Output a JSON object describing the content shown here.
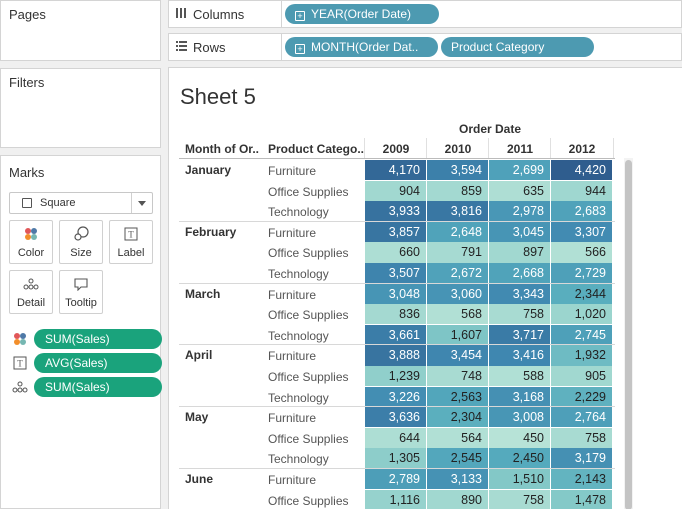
{
  "panels": {
    "pages": "Pages",
    "filters": "Filters",
    "marks": "Marks"
  },
  "marks": {
    "type": "Square",
    "buttons": [
      {
        "label": "Color",
        "icon": "color-dots-icon"
      },
      {
        "label": "Size",
        "icon": "size-icon"
      },
      {
        "label": "Label",
        "icon": "text-label-icon"
      },
      {
        "label": "Detail",
        "icon": "detail-dots-icon"
      },
      {
        "label": "Tooltip",
        "icon": "tooltip-icon"
      }
    ],
    "pills": [
      {
        "label": "SUM(Sales)",
        "icon": "color-dots-icon"
      },
      {
        "label": "AVG(Sales)",
        "icon": "text-label-icon"
      },
      {
        "label": "SUM(Sales)",
        "icon": "detail-dots-icon"
      }
    ]
  },
  "shelves": {
    "columns": {
      "label": "Columns",
      "pills": [
        "YEAR(Order Date)"
      ]
    },
    "rows": {
      "label": "Rows",
      "pills": [
        "MONTH(Order Dat..",
        "Product Category"
      ]
    }
  },
  "sheet": {
    "title": "Sheet 5",
    "column_group": "Order Date",
    "row_headers": [
      "Month of Or..",
      "Product Catego.."
    ],
    "years": [
      "2009",
      "2010",
      "2011",
      "2012"
    ]
  },
  "colors": {
    "pill_green": "#1aa37c",
    "pill_blue": "#4d9ab1",
    "scale_low": "#b7e3d7",
    "scale_high": "#2f5d8e"
  },
  "chart_data": {
    "type": "heatmap",
    "x": [
      "2009",
      "2010",
      "2011",
      "2012"
    ],
    "rows": [
      {
        "month": "January",
        "category": "Furniture",
        "values": [
          "4,170",
          "3,594",
          "2,699",
          "4,420"
        ]
      },
      {
        "month": "January",
        "category": "Office Supplies",
        "values": [
          "904",
          "859",
          "635",
          "944"
        ]
      },
      {
        "month": "January",
        "category": "Technology",
        "values": [
          "3,933",
          "3,816",
          "2,978",
          "2,683"
        ]
      },
      {
        "month": "February",
        "category": "Furniture",
        "values": [
          "3,857",
          "2,648",
          "3,045",
          "3,307"
        ]
      },
      {
        "month": "February",
        "category": "Office Supplies",
        "values": [
          "660",
          "791",
          "897",
          "566"
        ]
      },
      {
        "month": "February",
        "category": "Technology",
        "values": [
          "3,507",
          "2,672",
          "2,668",
          "2,729"
        ]
      },
      {
        "month": "March",
        "category": "Furniture",
        "values": [
          "3,048",
          "3,060",
          "3,343",
          "2,344"
        ]
      },
      {
        "month": "March",
        "category": "Office Supplies",
        "values": [
          "836",
          "568",
          "758",
          "1,020"
        ]
      },
      {
        "month": "March",
        "category": "Technology",
        "values": [
          "3,661",
          "1,607",
          "3,717",
          "2,745"
        ]
      },
      {
        "month": "April",
        "category": "Furniture",
        "values": [
          "3,888",
          "3,454",
          "3,416",
          "1,932"
        ]
      },
      {
        "month": "April",
        "category": "Office Supplies",
        "values": [
          "1,239",
          "748",
          "588",
          "905"
        ]
      },
      {
        "month": "April",
        "category": "Technology",
        "values": [
          "3,226",
          "2,563",
          "3,168",
          "2,229"
        ]
      },
      {
        "month": "May",
        "category": "Furniture",
        "values": [
          "3,636",
          "2,304",
          "3,008",
          "2,764"
        ]
      },
      {
        "month": "May",
        "category": "Office Supplies",
        "values": [
          "644",
          "564",
          "450",
          "758"
        ]
      },
      {
        "month": "May",
        "category": "Technology",
        "values": [
          "1,305",
          "2,545",
          "2,450",
          "3,179"
        ]
      },
      {
        "month": "June",
        "category": "Furniture",
        "values": [
          "2,789",
          "3,133",
          "1,510",
          "2,143"
        ]
      },
      {
        "month": "June",
        "category": "Office Supplies",
        "values": [
          "1,116",
          "890",
          "758",
          "1,478"
        ]
      }
    ]
  }
}
